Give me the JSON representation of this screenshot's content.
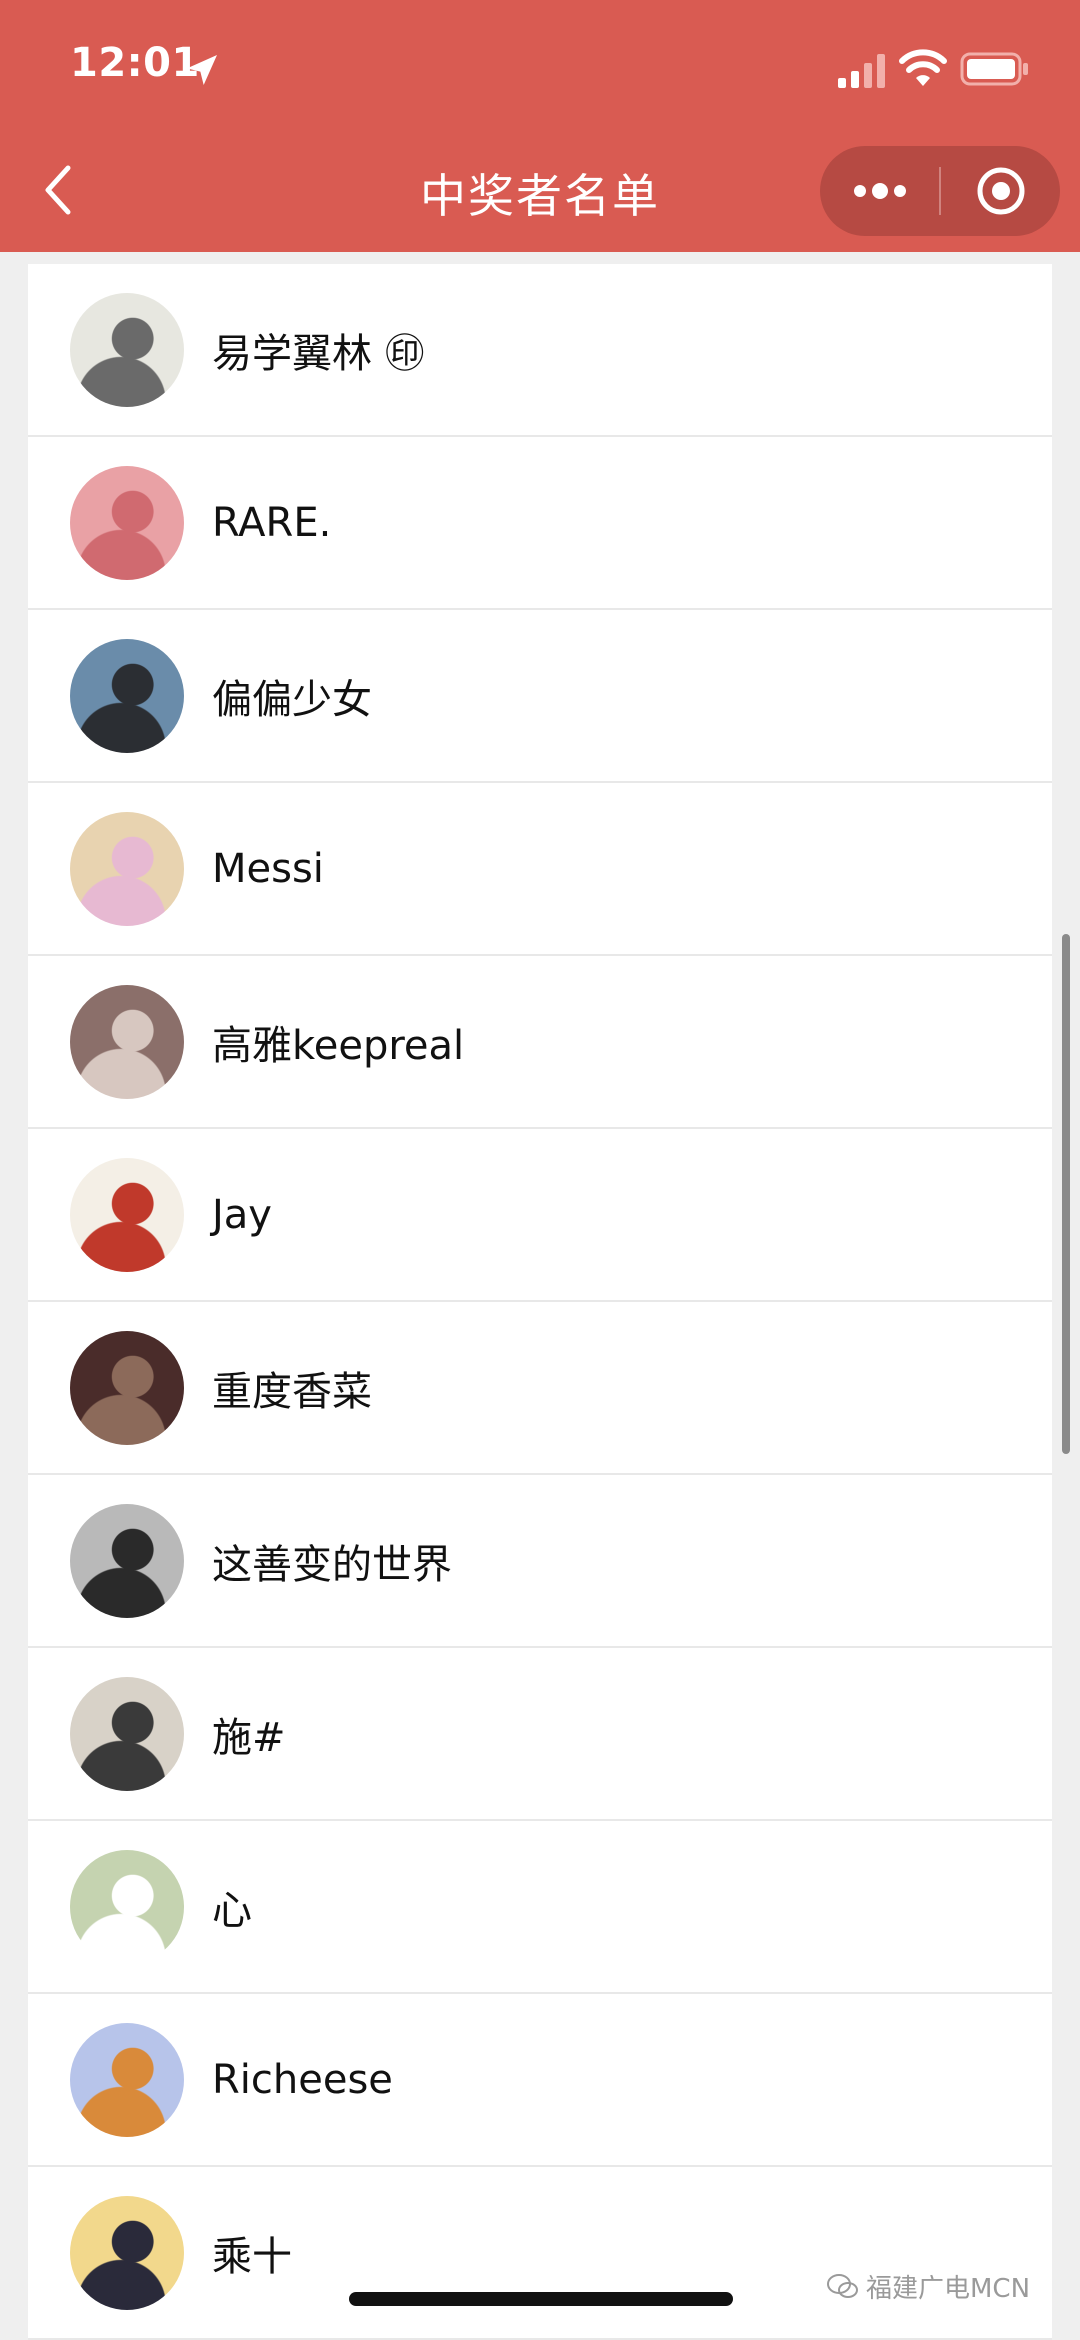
{
  "status": {
    "time": "12:01"
  },
  "header": {
    "title": "中奖者名单"
  },
  "winners": [
    {
      "name": "易学翼林 ㊞",
      "avatar": {
        "bg": "#e7e7e0",
        "accent": "#6a6a6a"
      }
    },
    {
      "name": "RARE.",
      "avatar": {
        "bg": "#e9a1a5",
        "accent": "#d06a70"
      }
    },
    {
      "name": "偏偏少女",
      "avatar": {
        "bg": "#6a8caa",
        "accent": "#2b2e33"
      }
    },
    {
      "name": "Messi",
      "avatar": {
        "bg": "#e8d3b0",
        "accent": "#e7b9d2"
      }
    },
    {
      "name": "高雅keepreal",
      "avatar": {
        "bg": "#8b6f6a",
        "accent": "#d7c7c0"
      }
    },
    {
      "name": "Jay",
      "avatar": {
        "bg": "#f4efe6",
        "accent": "#c0392b"
      }
    },
    {
      "name": "重度香菜",
      "avatar": {
        "bg": "#4a2c2a",
        "accent": "#8c6a5a"
      }
    },
    {
      "name": "这善变的世界",
      "avatar": {
        "bg": "#b9b9b9",
        "accent": "#2a2a2a"
      }
    },
    {
      "name": "施#",
      "avatar": {
        "bg": "#d8d2c8",
        "accent": "#3a3a3a"
      }
    },
    {
      "name": "心",
      "avatar": {
        "bg": "#c5d3b0",
        "accent": "#ffffff"
      }
    },
    {
      "name": "Richeese",
      "avatar": {
        "bg": "#b7c4ea",
        "accent": "#d98a3a"
      }
    },
    {
      "name": "乘十",
      "avatar": {
        "bg": "#f2d88c",
        "accent": "#2a2a3a"
      }
    }
  ],
  "watermark": {
    "text": "福建广电MCN"
  },
  "colors": {
    "header": "#d95b52",
    "capsule": "#b64a43"
  }
}
